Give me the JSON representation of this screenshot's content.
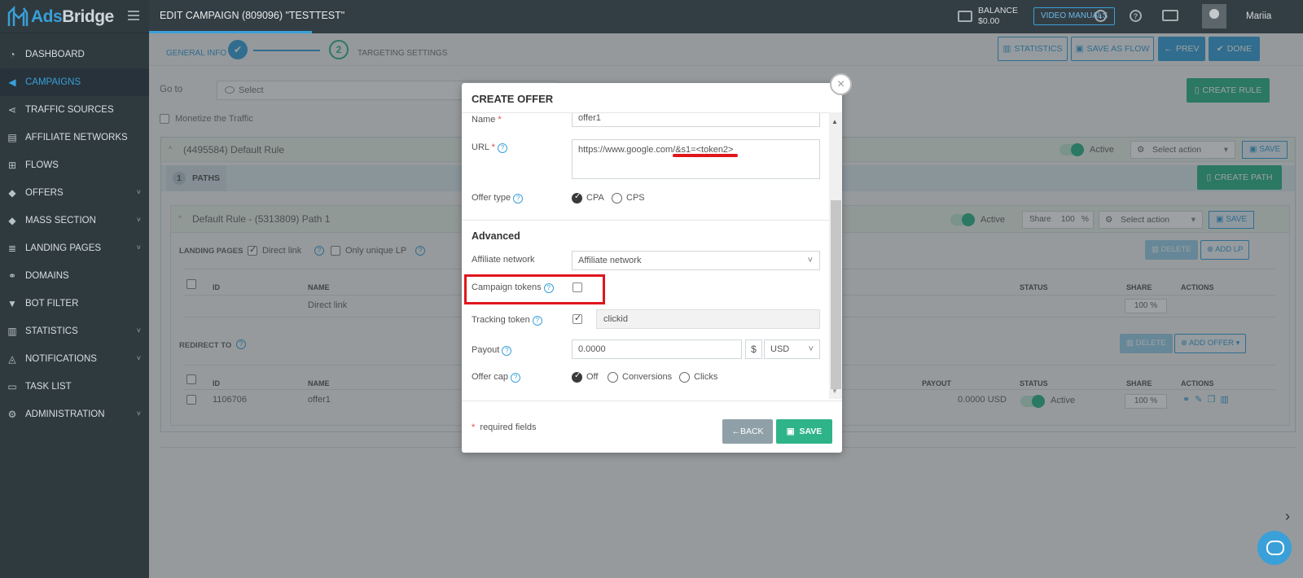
{
  "app": {
    "logo_text_prefix": "Ads",
    "logo_text_suffix": "Bridge"
  },
  "sidebar": {
    "items": [
      {
        "label": "DASHBOARD",
        "icon": "dashboard-icon"
      },
      {
        "label": "CAMPAIGNS",
        "icon": "megaphone-icon",
        "active": true
      },
      {
        "label": "TRAFFIC SOURCES",
        "icon": "share-icon"
      },
      {
        "label": "AFFILIATE NETWORKS",
        "icon": "briefcase-icon"
      },
      {
        "label": "FLOWS",
        "icon": "sitemap-icon"
      },
      {
        "label": "OFFERS",
        "icon": "tag-icon",
        "chevron": true
      },
      {
        "label": "MASS SECTION",
        "icon": "tags-icon",
        "chevron": true
      },
      {
        "label": "LANDING PAGES",
        "icon": "list-icon",
        "chevron": true
      },
      {
        "label": "DOMAINS",
        "icon": "link-icon"
      },
      {
        "label": "BOT FILTER",
        "icon": "filter-icon"
      },
      {
        "label": "STATISTICS",
        "icon": "bar-chart-icon",
        "chevron": true
      },
      {
        "label": "NOTIFICATIONS",
        "icon": "bell-icon",
        "chevron": true
      },
      {
        "label": "TASK LIST",
        "icon": "task-icon"
      },
      {
        "label": "ADMINISTRATION",
        "icon": "gear-icon",
        "chevron": true
      }
    ]
  },
  "header": {
    "title": "EDIT CAMPAIGN (809096) \"TESTTEST\"",
    "balance_label": "BALANCE",
    "balance_value": "$0.00",
    "video_manuals": "VIDEO MANUALS",
    "user_name": "Mariia"
  },
  "wizard": {
    "step1": "GENERAL INFO",
    "step2_num": "2",
    "step2": "TARGETING SETTINGS"
  },
  "toolbar": {
    "statistics": "STATISTICS",
    "save_as_flow": "SAVE AS FLOW",
    "prev": "PREV",
    "done": "DONE",
    "create_rule": "CREATE RULE"
  },
  "goto": {
    "label": "Go to",
    "placeholder": "Select"
  },
  "monetize": {
    "label": "Monetize the Traffic"
  },
  "rule": {
    "title": "(4495584) Default Rule",
    "active": "Active",
    "select_action": "Select action",
    "save": "SAVE",
    "paths_num": "1",
    "paths_label": "PATHS",
    "create_path": "CREATE PATH"
  },
  "path": {
    "title": "Default Rule - (5313809) Path 1",
    "active": "Active",
    "share_label": "Share",
    "share_value": "100",
    "share_unit": "%",
    "select_action": "Select action",
    "save": "SAVE",
    "landing_pages": "LANDING PAGES",
    "direct_link": "Direct link",
    "only_unique_lp": "Only unique LP",
    "delete": "DELETE",
    "add_lp": "ADD LP",
    "lp_headers": {
      "id": "ID",
      "name": "NAME",
      "status": "STATUS",
      "share": "SHARE",
      "actions": "ACTIONS"
    },
    "lp_row": {
      "name": "Direct link",
      "share": "100 %"
    },
    "redirect_to": "REDIRECT TO",
    "add_offer": "ADD OFFER",
    "offer_headers": {
      "id": "ID",
      "name": "NAME",
      "payout": "PAYOUT",
      "status": "STATUS",
      "share": "SHARE",
      "actions": "ACTIONS"
    },
    "offer_row": {
      "id": "1106706",
      "name": "offer1",
      "payout": "0.0000 USD",
      "status": "Active",
      "share": "100 %"
    }
  },
  "modal": {
    "title": "CREATE OFFER",
    "name_label": "Name",
    "name_value": "offer1",
    "url_label": "URL",
    "url_value": "https://www.google.com/&s1=<token2>",
    "offer_type_label": "Offer type",
    "offer_type_options": [
      "CPA",
      "CPS"
    ],
    "offer_type_selected": "CPA",
    "advanced": "Advanced",
    "affiliate_network_label": "Affiliate network",
    "affiliate_network_value": "Affiliate network",
    "campaign_tokens_label": "Campaign tokens",
    "tracking_token_label": "Tracking token",
    "tracking_token_value": "clickid",
    "payout_label": "Payout",
    "payout_value": "0.0000",
    "currency_symbol": "$",
    "currency": "USD",
    "offer_cap_label": "Offer cap",
    "offer_cap_options": [
      "Off",
      "Conversions",
      "Clicks"
    ],
    "offer_cap_selected": "Off",
    "required_note": "required fields",
    "required_star": "*",
    "back": "←BACK",
    "save": "SAVE"
  },
  "colors": {
    "accent": "#3aa0d9",
    "green": "#2fb48a",
    "highlight": "#e0161c",
    "sidebar": "#2f3a3f"
  }
}
